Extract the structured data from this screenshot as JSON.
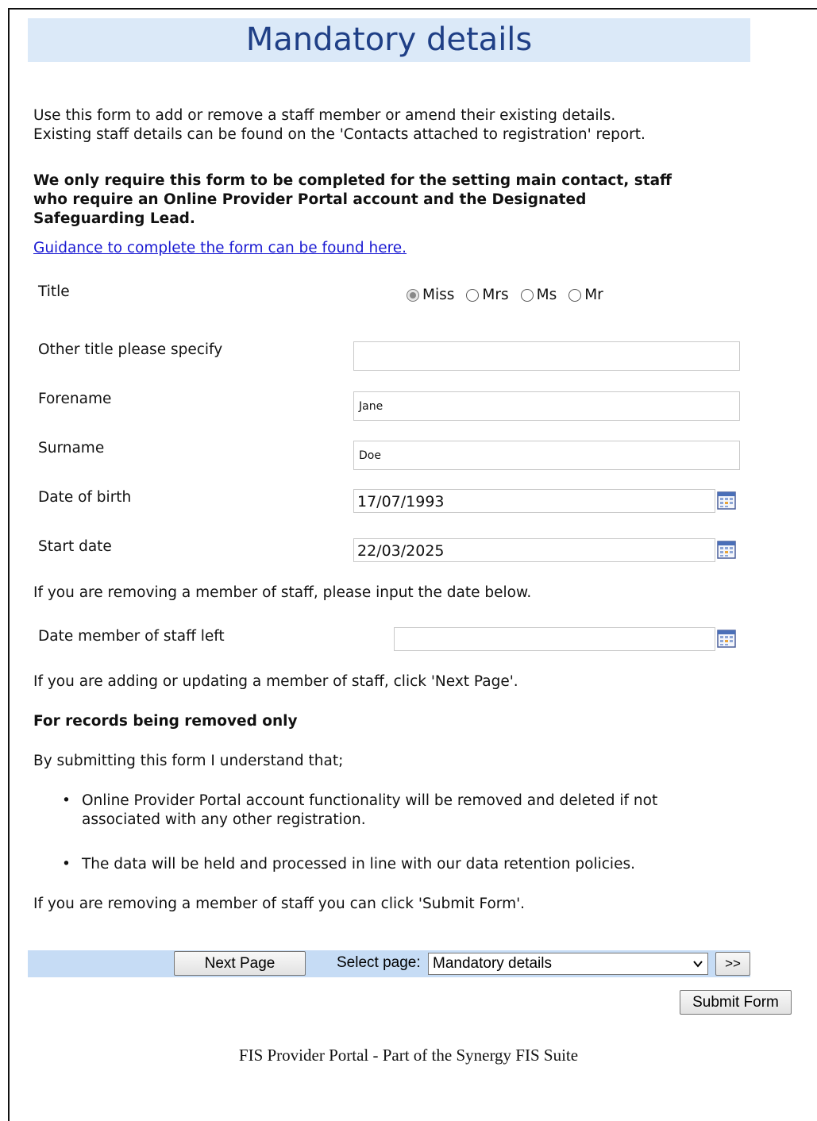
{
  "header": {
    "title": "Mandatory details"
  },
  "intro": {
    "line1": "Use this form to add or remove a staff member or amend their existing details.",
    "line2": "Existing staff details can be found on the 'Contacts attached to registration' report.",
    "bold_line1": "We only require this form to be completed for the setting main contact, staff",
    "bold_line2": "who require an Online Provider Portal account and the Designated",
    "bold_line3": "Safeguarding Lead.",
    "guidance_link": "Guidance to complete the form can be found here."
  },
  "form": {
    "title_label": "Title",
    "title_options": [
      {
        "label": "Miss",
        "checked": true
      },
      {
        "label": "Mrs",
        "checked": false
      },
      {
        "label": "Ms",
        "checked": false
      },
      {
        "label": "Mr",
        "checked": false
      }
    ],
    "other_title_label": "Other title please specify",
    "other_title_value": "",
    "forename_label": "Forename",
    "forename_value": "Jane",
    "surname_label": "Surname",
    "surname_value": "Doe",
    "dob_label": "Date of birth",
    "dob_value": "17/07/1993",
    "start_label": "Start date",
    "start_value": "22/03/2025",
    "removing_note": "If you are removing a member of staff, please input the date below.",
    "left_label": "Date member of staff left",
    "left_value": "",
    "adding_note": "If you are adding or updating a member of staff, click 'Next Page'."
  },
  "removal": {
    "heading": "For records being removed only",
    "intro": "By submitting this form I understand that;",
    "bullet1_line1": "Online Provider Portal account functionality will be removed and deleted if not",
    "bullet1_line2": "associated with any other registration.",
    "bullet2": "The data will be held and processed in line with our data retention policies.",
    "submit_note": "If you are removing a member of staff you can click 'Submit Form'."
  },
  "nav": {
    "next_page": "Next Page",
    "select_label": "Select page:",
    "selected_page": "Mandatory details",
    "go": ">>",
    "submit": "Submit Form"
  },
  "footer": {
    "text": "FIS Provider Portal - Part of the Synergy FIS Suite"
  }
}
